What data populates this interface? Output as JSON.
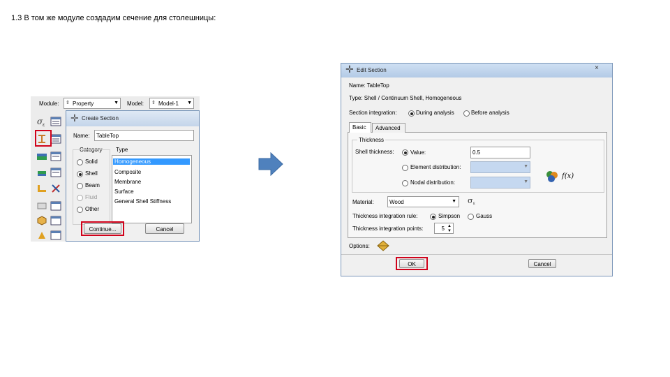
{
  "slide": {
    "title": "1.3 В том же модуле создадим сечение для столешницы:"
  },
  "toolbar": {
    "module_label": "Module:",
    "module_value": "Property",
    "model_label": "Model:",
    "model_value": "Model-1"
  },
  "create_section": {
    "title": "Create Section",
    "name_label": "Name:",
    "name_value": "TableTop",
    "category_label": "Category",
    "type_label": "Type",
    "categories": [
      "Solid",
      "Shell",
      "Beam",
      "Fluid",
      "Other"
    ],
    "types": [
      "Homogeneous",
      "Composite",
      "Membrane",
      "Surface",
      "General Shell Stiffness"
    ],
    "continue_label": "Continue...",
    "cancel_label": "Cancel"
  },
  "edit_section": {
    "title": "Edit Section",
    "close_icon": "×",
    "name_line": "Name:  TableTop",
    "type_line": "Type:   Shell / Continuum Shell, Homogeneous",
    "section_integration_label": "Section integration:",
    "during_analysis": "During analysis",
    "before_analysis": "Before analysis",
    "tabs": [
      "Basic",
      "Advanced"
    ],
    "thickness_group": "Thickness",
    "shell_thickness_label": "Shell thickness:",
    "value_option": "Value:",
    "value": "0.5",
    "element_distribution": "Element distribution:",
    "nodal_distribution": "Nodal distribution:",
    "fx_label": "f(x)",
    "material_label": "Material:",
    "material_value": "Wood",
    "thickness_rule_label": "Thickness integration rule:",
    "simpson": "Simpson",
    "gauss": "Gauss",
    "thickness_points_label": "Thickness integration points:",
    "thickness_points": "5",
    "options_label": "Options:",
    "ok_label": "OK",
    "cancel_label": "Cancel"
  },
  "colors": {
    "highlight": "#d0021b",
    "selection": "#3399ff",
    "arrow": "#4f81bd",
    "disabled_field": "#c5d8f0"
  }
}
